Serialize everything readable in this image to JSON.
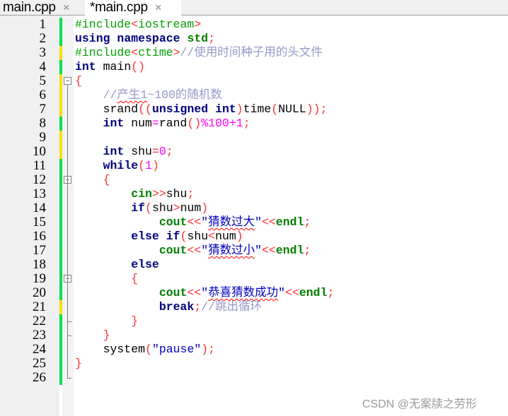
{
  "tabs": [
    {
      "label": "main.cpp",
      "close_icon": "×",
      "active": false
    },
    {
      "label": "*main.cpp",
      "close_icon": "×",
      "active": true
    }
  ],
  "change_colors": {
    "saved": "#00e050",
    "modified": "#ffe000"
  },
  "lines": [
    {
      "n": "1",
      "change": "saved",
      "tokens": [
        {
          "t": "#include",
          "c": "pp"
        },
        {
          "t": "<",
          "c": "op"
        },
        {
          "t": "iostream",
          "c": "pp"
        },
        {
          "t": ">",
          "c": "op"
        }
      ]
    },
    {
      "n": "2",
      "change": "saved",
      "tokens": [
        {
          "t": "using",
          "c": "k"
        },
        {
          "t": " ",
          "c": ""
        },
        {
          "t": "namespace",
          "c": "k"
        },
        {
          "t": " ",
          "c": ""
        },
        {
          "t": "std",
          "c": "g"
        },
        {
          "t": ";",
          "c": "op"
        }
      ]
    },
    {
      "n": "3",
      "change": "modified",
      "tokens": [
        {
          "t": "#include",
          "c": "pp"
        },
        {
          "t": "<",
          "c": "op"
        },
        {
          "t": "ctime",
          "c": "pp"
        },
        {
          "t": ">",
          "c": "op"
        },
        {
          "t": "//使用时间种子用的头文件",
          "c": "cm"
        }
      ]
    },
    {
      "n": "4",
      "change": "saved",
      "tokens": [
        {
          "t": "int",
          "c": "k"
        },
        {
          "t": " main",
          "c": ""
        },
        {
          "t": "()",
          "c": "op"
        }
      ]
    },
    {
      "n": "5",
      "change": "modified",
      "tokens": [
        {
          "t": "{",
          "c": "op"
        }
      ]
    },
    {
      "n": "6",
      "change": "modified",
      "tokens": [
        {
          "t": "    ",
          "c": ""
        },
        {
          "t": "//",
          "c": "cm"
        },
        {
          "t": "产生1",
          "c": "cm sq"
        },
        {
          "t": "~100的随机数",
          "c": "cm"
        }
      ]
    },
    {
      "n": "7",
      "change": "modified",
      "tokens": [
        {
          "t": "    srand",
          "c": ""
        },
        {
          "t": "((",
          "c": "op"
        },
        {
          "t": "unsigned",
          "c": "k"
        },
        {
          "t": " ",
          "c": ""
        },
        {
          "t": "int",
          "c": "k"
        },
        {
          "t": ")",
          "c": "op"
        },
        {
          "t": "time",
          "c": ""
        },
        {
          "t": "(",
          "c": "op"
        },
        {
          "t": "NULL",
          "c": ""
        },
        {
          "t": "));",
          "c": "op"
        }
      ]
    },
    {
      "n": "8",
      "change": "saved",
      "tokens": [
        {
          "t": "    ",
          "c": ""
        },
        {
          "t": "int",
          "c": "k"
        },
        {
          "t": " num",
          "c": ""
        },
        {
          "t": "=",
          "c": "num"
        },
        {
          "t": "rand",
          "c": ""
        },
        {
          "t": "()",
          "c": "op"
        },
        {
          "t": "%100+1",
          "c": "num"
        },
        {
          "t": ";",
          "c": "op"
        }
      ]
    },
    {
      "n": "9",
      "change": "modified",
      "tokens": []
    },
    {
      "n": "10",
      "change": "modified",
      "tokens": [
        {
          "t": "    ",
          "c": ""
        },
        {
          "t": "int",
          "c": "k"
        },
        {
          "t": " shu",
          "c": ""
        },
        {
          "t": "=",
          "c": "op"
        },
        {
          "t": "0",
          "c": "num"
        },
        {
          "t": ";",
          "c": "op"
        }
      ]
    },
    {
      "n": "11",
      "change": "saved",
      "tokens": [
        {
          "t": "    ",
          "c": ""
        },
        {
          "t": "while",
          "c": "k"
        },
        {
          "t": "(",
          "c": "op"
        },
        {
          "t": "1",
          "c": "num"
        },
        {
          "t": ")",
          "c": "op"
        }
      ]
    },
    {
      "n": "12",
      "change": "saved",
      "tokens": [
        {
          "t": "    ",
          "c": ""
        },
        {
          "t": "{",
          "c": "op"
        }
      ]
    },
    {
      "n": "13",
      "change": "saved",
      "tokens": [
        {
          "t": "        ",
          "c": ""
        },
        {
          "t": "cin",
          "c": "g"
        },
        {
          "t": ">>",
          "c": "op"
        },
        {
          "t": "shu",
          "c": ""
        },
        {
          "t": ";",
          "c": "op"
        }
      ]
    },
    {
      "n": "14",
      "change": "saved",
      "tokens": [
        {
          "t": "        ",
          "c": ""
        },
        {
          "t": "if",
          "c": "k"
        },
        {
          "t": "(",
          "c": "op"
        },
        {
          "t": "shu",
          "c": ""
        },
        {
          "t": ">",
          "c": "op"
        },
        {
          "t": "num",
          "c": ""
        },
        {
          "t": ")",
          "c": "op"
        }
      ]
    },
    {
      "n": "15",
      "change": "saved",
      "tokens": [
        {
          "t": "            ",
          "c": ""
        },
        {
          "t": "cout",
          "c": "g"
        },
        {
          "t": "<<",
          "c": "op"
        },
        {
          "t": "\"",
          "c": "str"
        },
        {
          "t": "猜数过大",
          "c": "str sq"
        },
        {
          "t": "\"",
          "c": "str"
        },
        {
          "t": "<<",
          "c": "op"
        },
        {
          "t": "endl",
          "c": "g"
        },
        {
          "t": ";",
          "c": "op"
        }
      ]
    },
    {
      "n": "16",
      "change": "saved",
      "tokens": [
        {
          "t": "        ",
          "c": ""
        },
        {
          "t": "else",
          "c": "k"
        },
        {
          "t": " ",
          "c": ""
        },
        {
          "t": "if",
          "c": "k"
        },
        {
          "t": "(",
          "c": "op"
        },
        {
          "t": "shu",
          "c": ""
        },
        {
          "t": "<",
          "c": "op"
        },
        {
          "t": "num",
          "c": ""
        },
        {
          "t": ")",
          "c": "op"
        }
      ]
    },
    {
      "n": "17",
      "change": "saved",
      "tokens": [
        {
          "t": "            ",
          "c": ""
        },
        {
          "t": "cout",
          "c": "g"
        },
        {
          "t": "<<",
          "c": "op"
        },
        {
          "t": "\"",
          "c": "str"
        },
        {
          "t": "猜数过小",
          "c": "str sq"
        },
        {
          "t": "\"",
          "c": "str"
        },
        {
          "t": "<<",
          "c": "op"
        },
        {
          "t": "endl",
          "c": "g"
        },
        {
          "t": ";",
          "c": "op"
        }
      ]
    },
    {
      "n": "18",
      "change": "saved",
      "tokens": [
        {
          "t": "        ",
          "c": ""
        },
        {
          "t": "else",
          "c": "k"
        }
      ]
    },
    {
      "n": "19",
      "change": "saved",
      "tokens": [
        {
          "t": "        ",
          "c": ""
        },
        {
          "t": "{",
          "c": "op"
        }
      ]
    },
    {
      "n": "20",
      "change": "saved",
      "tokens": [
        {
          "t": "            ",
          "c": ""
        },
        {
          "t": "cout",
          "c": "g"
        },
        {
          "t": "<<",
          "c": "op"
        },
        {
          "t": "\"",
          "c": "str"
        },
        {
          "t": "恭喜猜数成功",
          "c": "str sq"
        },
        {
          "t": "\"",
          "c": "str"
        },
        {
          "t": "<<",
          "c": "op"
        },
        {
          "t": "endl",
          "c": "g"
        },
        {
          "t": ";",
          "c": "op"
        }
      ]
    },
    {
      "n": "21",
      "change": "modified",
      "tokens": [
        {
          "t": "            ",
          "c": ""
        },
        {
          "t": "break",
          "c": "k"
        },
        {
          "t": ";",
          "c": "op"
        },
        {
          "t": "//跳出循环",
          "c": "cm"
        }
      ]
    },
    {
      "n": "22",
      "change": "saved",
      "tokens": [
        {
          "t": "        ",
          "c": ""
        },
        {
          "t": "}",
          "c": "op"
        }
      ]
    },
    {
      "n": "23",
      "change": "saved",
      "tokens": [
        {
          "t": "    ",
          "c": ""
        },
        {
          "t": "}",
          "c": "op"
        }
      ]
    },
    {
      "n": "24",
      "change": "saved",
      "tokens": [
        {
          "t": "    system",
          "c": ""
        },
        {
          "t": "(",
          "c": "op"
        },
        {
          "t": "\"pause\"",
          "c": "str"
        },
        {
          "t": ");",
          "c": "op"
        }
      ]
    },
    {
      "n": "25",
      "change": "saved",
      "tokens": [
        {
          "t": "}",
          "c": "op"
        }
      ]
    },
    {
      "n": "26",
      "change": "saved",
      "tokens": []
    }
  ],
  "folds": {
    "boxes": [
      "5",
      "12",
      "19"
    ],
    "ends": [
      "22",
      "23",
      "26"
    ]
  },
  "watermark": "CSDN @无案牍之劳形"
}
